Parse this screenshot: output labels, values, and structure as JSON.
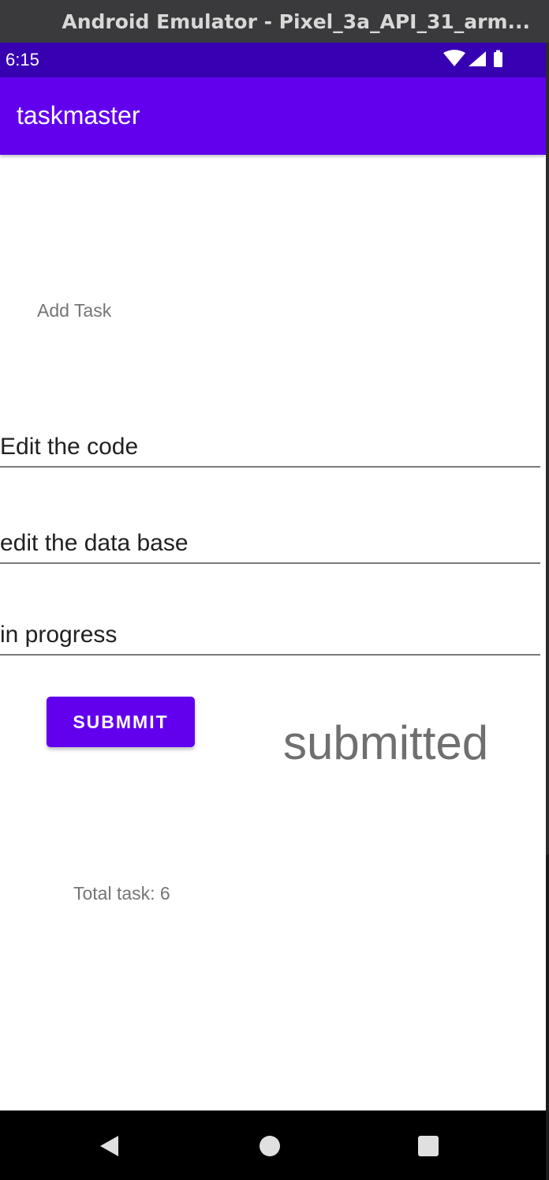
{
  "window": {
    "title": "Android Emulator - Pixel_3a_API_31_arm..."
  },
  "status_bar": {
    "time": "6:15",
    "icons": [
      "wifi-icon",
      "cellular-signal-icon",
      "battery-icon"
    ]
  },
  "app_bar": {
    "title": "taskmaster"
  },
  "form": {
    "heading": "Add Task",
    "title_value": "Edit the code",
    "body_value": "edit the data base",
    "state_value": "in progress",
    "submit_label": "SUBMMIT",
    "status_text": "submitted",
    "total_label": "Total task: 6"
  },
  "nav_bar": {
    "icons": [
      "back-icon",
      "home-icon",
      "recents-icon"
    ]
  },
  "colors": {
    "status_bar": "#3700b3",
    "primary": "#6200ee",
    "background": "#ffffff",
    "secondary_text": "#757575"
  }
}
